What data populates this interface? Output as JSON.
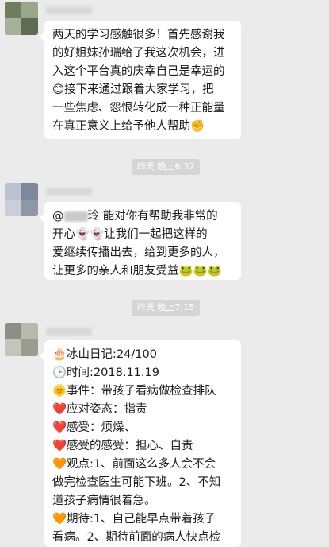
{
  "messages": [
    {
      "lines": [
        "两天的学习感触很多！首先感谢我",
        "的好姐妹孙瑞给了我这次机会，进",
        "入这个平台真的庆幸自己是幸运的",
        "😊接下来通过跟着大家学习，把",
        "一些焦虑、怨恨转化成一种正能量",
        "在真正意义上给予他人帮助✊"
      ]
    },
    {
      "lines": [
        "@",
        "开心👻👻让我们一起把这样的",
        "爱继续传播出去，给到更多的人，",
        "让更多的亲人和朋友受益🐸🐸🐸"
      ],
      "first_line_rest": "玲  能对你有帮助我非常的"
    },
    {
      "lines": [
        "🎂冰山日记:24/100",
        "🕒时间:2018.11.19",
        "🌞事件：带孩子看病做检查排队",
        "❤️应对姿态：指责",
        "❤️感受：烦燥、",
        "❤️感受的感受：担心、自责",
        "🧡观点:1、前面这么多人会不会",
        "做完检查医生可能下班。2、不知",
        "道孩子病情很着急。",
        "🧡期待:1、自己能早点带着孩子",
        "看病。2、期待前面的病人快点检"
      ]
    }
  ],
  "timestamps": [
    "昨天 晚上6:37",
    "昨天 晚上7:15"
  ]
}
